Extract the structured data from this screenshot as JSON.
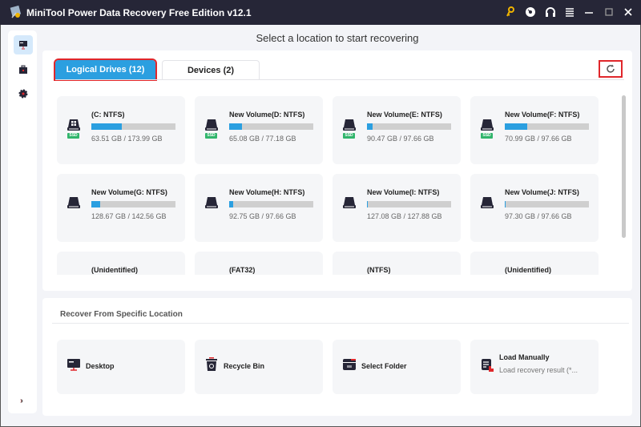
{
  "window": {
    "title": "MiniTool Power Data Recovery Free Edition v12.1",
    "controls": [
      "key-icon",
      "disc-icon",
      "headphones-icon",
      "menu-icon",
      "minimize-icon",
      "maximize-icon",
      "close-icon"
    ],
    "accent_key_color": "#f0b400"
  },
  "sidebar": {
    "items": [
      {
        "name": "this-pc",
        "icon": "monitor-icon",
        "active": true
      },
      {
        "name": "toolkit",
        "icon": "toolbox-icon",
        "active": false
      },
      {
        "name": "settings",
        "icon": "gear-icon",
        "active": false
      }
    ],
    "expand_icon": "double-chevron-right-icon"
  },
  "main": {
    "heading": "Select a location to start recovering",
    "tabs": [
      {
        "label": "Logical Drives (12)",
        "active": true
      },
      {
        "label": "Devices (2)",
        "active": false
      }
    ],
    "refresh_icon": "refresh-icon",
    "drives": [
      {
        "name": "(C: NTFS)",
        "used": "63.51 GB",
        "total": "173.99 GB",
        "size": "63.51 GB / 173.99 GB",
        "used_fraction": 0.365,
        "ssd": true,
        "windows": true,
        "ssd_label": "SSD"
      },
      {
        "name": "New Volume(D: NTFS)",
        "used": "65.08 GB",
        "total": "77.18 GB",
        "size": "65.08 GB / 77.18 GB",
        "used_fraction": 0.15,
        "ssd": true,
        "ssd_label": "SSD"
      },
      {
        "name": "New Volume(E: NTFS)",
        "used": "90.47 GB",
        "total": "97.66 GB",
        "size": "90.47 GB / 97.66 GB",
        "used_fraction": 0.07,
        "ssd": true,
        "ssd_label": "SSD"
      },
      {
        "name": "New Volume(F: NTFS)",
        "used": "70.99 GB",
        "total": "97.66 GB",
        "size": "70.99 GB / 97.66 GB",
        "used_fraction": 0.27,
        "ssd": true,
        "ssd_label": "SSD"
      },
      {
        "name": "New Volume(G: NTFS)",
        "used": "128.67 GB",
        "total": "142.56 GB",
        "size": "128.67 GB / 142.56 GB",
        "used_fraction": 0.1,
        "ssd": false
      },
      {
        "name": "New Volume(H: NTFS)",
        "used": "92.75 GB",
        "total": "97.66 GB",
        "size": "92.75 GB / 97.66 GB",
        "used_fraction": 0.05,
        "ssd": false
      },
      {
        "name": "New Volume(I: NTFS)",
        "used": "127.08 GB",
        "total": "127.88 GB",
        "size": "127.08 GB / 127.88 GB",
        "used_fraction": 0.006,
        "ssd": false
      },
      {
        "name": "New Volume(J: NTFS)",
        "used": "97.30 GB",
        "total": "97.66 GB",
        "size": "97.30 GB / 97.66 GB",
        "used_fraction": 0.004,
        "ssd": false
      },
      {
        "name": "(Unidentified)"
      },
      {
        "name": "(FAT32)"
      },
      {
        "name": "(NTFS)"
      },
      {
        "name": "(Unidentified)"
      }
    ]
  },
  "specific": {
    "title": "Recover From Specific Location",
    "items": [
      {
        "label": "Desktop",
        "icon": "desktop-icon"
      },
      {
        "label": "Recycle Bin",
        "icon": "recycle-bin-icon"
      },
      {
        "label": "Select Folder",
        "icon": "folder-icon"
      },
      {
        "label": "Load Manually",
        "sub": "Load recovery result (*...",
        "icon": "load-file-icon"
      }
    ]
  },
  "colors": {
    "accent": "#2b9fe0",
    "highlight": "#e0272b",
    "ssd": "#30b56b"
  }
}
